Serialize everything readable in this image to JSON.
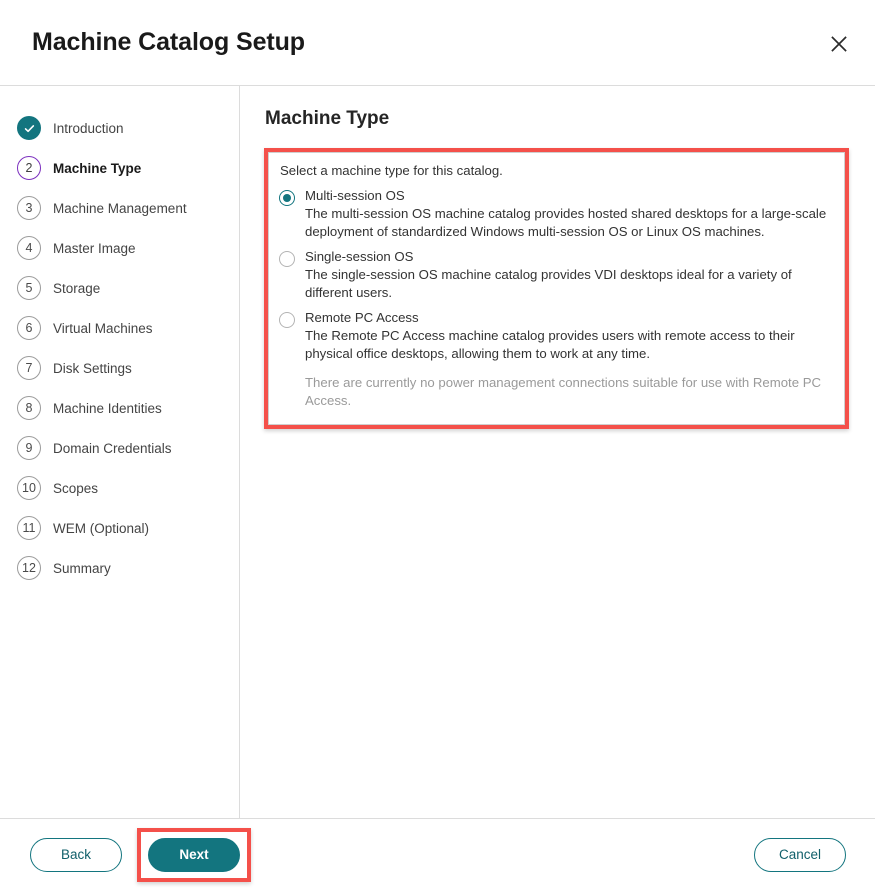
{
  "header": {
    "title": "Machine Catalog Setup",
    "close_icon": "close-icon"
  },
  "sidebar": {
    "steps": [
      {
        "number": "1",
        "label": "Introduction",
        "state": "done"
      },
      {
        "number": "2",
        "label": "Machine Type",
        "state": "current"
      },
      {
        "number": "3",
        "label": "Machine Management",
        "state": "pending"
      },
      {
        "number": "4",
        "label": "Master Image",
        "state": "pending"
      },
      {
        "number": "5",
        "label": "Storage",
        "state": "pending"
      },
      {
        "number": "6",
        "label": "Virtual Machines",
        "state": "pending"
      },
      {
        "number": "7",
        "label": "Disk Settings",
        "state": "pending"
      },
      {
        "number": "8",
        "label": "Machine Identities",
        "state": "pending"
      },
      {
        "number": "9",
        "label": "Domain Credentials",
        "state": "pending"
      },
      {
        "number": "10",
        "label": "Scopes",
        "state": "pending"
      },
      {
        "number": "11",
        "label": "WEM (Optional)",
        "state": "pending"
      },
      {
        "number": "12",
        "label": "Summary",
        "state": "pending"
      }
    ]
  },
  "main": {
    "title": "Machine Type",
    "intro": "Select a machine type for this catalog.",
    "options": [
      {
        "label": "Multi-session OS",
        "description": "The multi-session OS machine catalog provides hosted shared desktops for a large-scale deployment of standardized Windows multi-session OS or Linux OS machines.",
        "selected": true
      },
      {
        "label": "Single-session OS",
        "description": "The single-session OS machine catalog provides VDI desktops ideal for a variety of different users.",
        "selected": false
      },
      {
        "label": "Remote PC Access",
        "description": "The Remote PC Access machine catalog provides users with remote access to their physical office desktops, allowing them to work at any time.",
        "note": "There are currently no power management connections suitable for use with Remote PC Access.",
        "selected": false
      }
    ]
  },
  "footer": {
    "back_label": "Back",
    "next_label": "Next",
    "cancel_label": "Cancel"
  },
  "colors": {
    "accent": "#13757f",
    "current_step": "#7b2fbe",
    "highlight": "#f4504a",
    "muted_text": "#9a9a9a"
  }
}
